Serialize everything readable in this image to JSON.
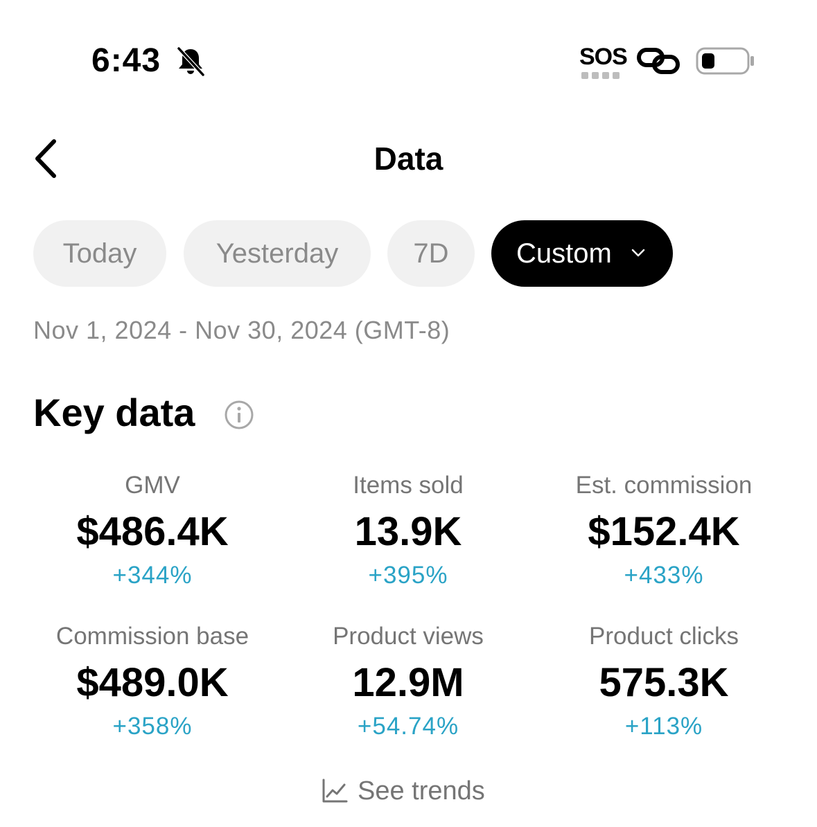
{
  "status_bar": {
    "time": "6:43",
    "sos": "SOS",
    "icons": [
      "bell-slash-icon",
      "link-icon",
      "battery-icon"
    ]
  },
  "nav": {
    "title": "Data",
    "back_icon": "chevron-left-icon"
  },
  "filters": {
    "options": [
      "Today",
      "Yesterday",
      "7D",
      "Custom"
    ],
    "selected": "Custom",
    "date_range": "Nov 1, 2024 - Nov 30, 2024 (GMT-8)"
  },
  "key_data": {
    "title": "Key data",
    "info_icon": "info-icon",
    "metrics": [
      {
        "label": "GMV",
        "value": "$486.4K",
        "change": "+344%"
      },
      {
        "label": "Items sold",
        "value": "13.9K",
        "change": "+395%"
      },
      {
        "label": "Est. commission",
        "value": "$152.4K",
        "change": "+433%"
      },
      {
        "label": "Commission base",
        "value": "$489.0K",
        "change": "+358%"
      },
      {
        "label": "Product views",
        "value": "12.9M",
        "change": "+54.74%"
      },
      {
        "label": "Product clicks",
        "value": "575.3K",
        "change": "+113%"
      }
    ],
    "see_trends": "See trends"
  },
  "colors": {
    "positive_change": "#2aa3c6",
    "chip_selected_bg": "#000000",
    "chip_bg": "#f1f1f1",
    "muted_text": "#8a8a8a"
  }
}
